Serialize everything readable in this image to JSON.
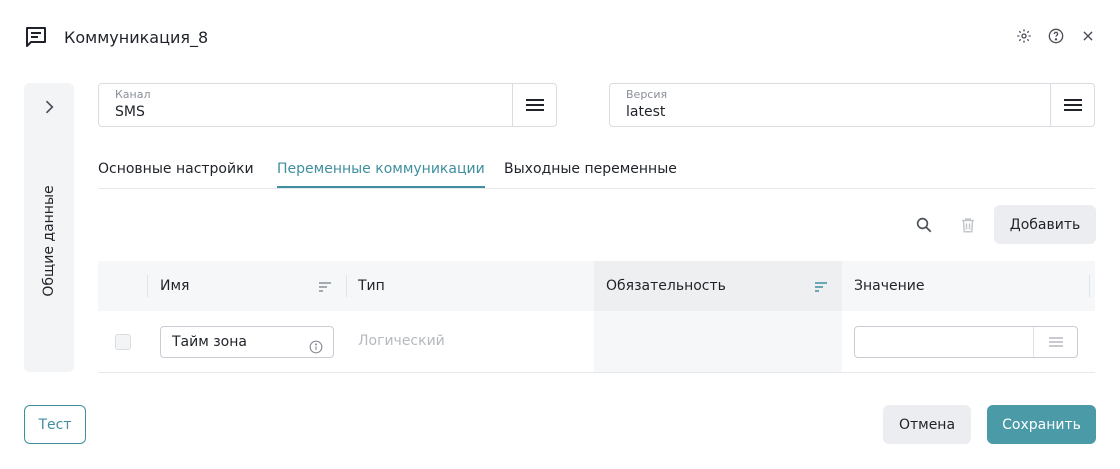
{
  "header": {
    "title": "Коммуникация_8",
    "icon": "message-icon",
    "actions": [
      "settings-icon",
      "help-icon",
      "close-icon"
    ]
  },
  "side_panel": {
    "label": "Общие данные",
    "icon": "chevron-right-icon"
  },
  "fields": {
    "channel": {
      "label": "Канал",
      "value": "SMS"
    },
    "version": {
      "label": "Версия",
      "value": "latest"
    }
  },
  "tabs": [
    {
      "label": "Основные настройки",
      "active": false
    },
    {
      "label": "Переменные коммуникации",
      "active": true
    },
    {
      "label": "Выходные переменные",
      "active": false
    }
  ],
  "toolbar": {
    "add_label": "Добавить",
    "icons": [
      "search-icon",
      "trash-icon"
    ]
  },
  "table": {
    "columns": [
      "Имя",
      "Тип",
      "Обязательность",
      "Значение"
    ],
    "rows": [
      {
        "name": "Тайм зона",
        "type": "Логический",
        "required": "",
        "value": ""
      }
    ]
  },
  "footer": {
    "test_label": "Тест",
    "cancel_label": "Отмена",
    "save_label": "Сохранить"
  },
  "colors": {
    "accent": "#3f8f9f",
    "primary_button": "#4a9aa8",
    "secondary_button": "#ebedf0"
  }
}
